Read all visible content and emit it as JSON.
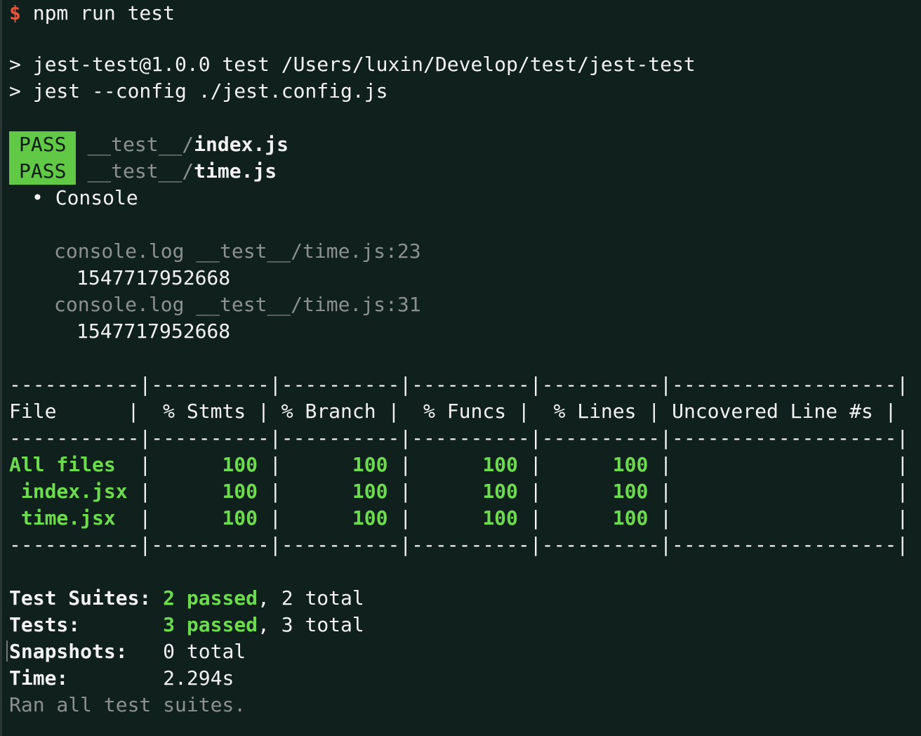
{
  "prompt": {
    "symbol": "$",
    "command": " npm run test"
  },
  "script_echo": {
    "line1": "> jest-test@1.0.0 test /Users/luxin/Develop/test/jest-test",
    "line2": "> jest --config ./jest.config.js"
  },
  "results": [
    {
      "badge": "PASS",
      "dir": "__test__/",
      "file": "index.js"
    },
    {
      "badge": "PASS",
      "dir": "__test__/",
      "file": "time.js"
    }
  ],
  "console": {
    "header": "• Console",
    "logs": [
      {
        "source": "console.log __test__/time.js:23",
        "value": "1547717952668"
      },
      {
        "source": "console.log __test__/time.js:31",
        "value": "1547717952668"
      }
    ]
  },
  "coverage": {
    "divider": "-----------|----------|----------|----------|----------|-------------------|",
    "columns": [
      "File",
      "% Stmts",
      "% Branch",
      "% Funcs",
      "% Lines",
      "Uncovered Line #s"
    ],
    "rows": [
      {
        "file": "All files",
        "stmts": "100",
        "branch": "100",
        "funcs": "100",
        "lines": "100",
        "uncovered": ""
      },
      {
        "file": " index.jsx",
        "stmts": "100",
        "branch": "100",
        "funcs": "100",
        "lines": "100",
        "uncovered": ""
      },
      {
        "file": " time.jsx",
        "stmts": "100",
        "branch": "100",
        "funcs": "100",
        "lines": "100",
        "uncovered": ""
      }
    ]
  },
  "summary": {
    "suites": {
      "label": "Test Suites:",
      "passed": "2 passed",
      "rest": ", 2 total"
    },
    "tests": {
      "label": "Tests:",
      "passed": "3 passed",
      "rest": ", 3 total"
    },
    "snapshots": {
      "label": "Snapshots:",
      "value": "0 total"
    },
    "time": {
      "label": "Time:",
      "value": "2.294s"
    },
    "footer": "Ran all test suites."
  },
  "colors": {
    "background": "#10201d",
    "pass_badge": "#61c945",
    "green_text": "#6ddb4f",
    "prompt_symbol": "#e8533b",
    "dim_text": "#8c918f"
  }
}
